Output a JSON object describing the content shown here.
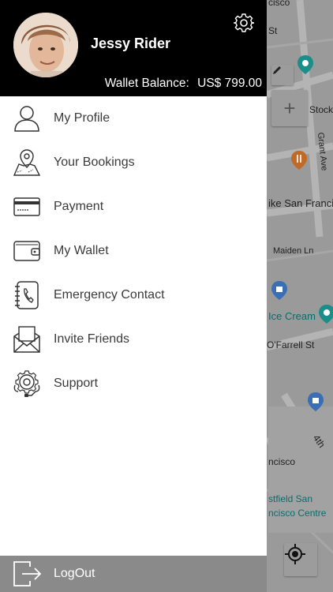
{
  "map": {
    "streets": [
      "cisco",
      "St",
      "Stockt",
      "Grant Ave",
      "ike San Franci",
      "Maiden Ln",
      "Ice Cream",
      "O'Farrell St",
      "4th",
      "ncisco",
      "stfield San",
      "ncisco Centre"
    ],
    "icons": [
      "pin-teal-icon",
      "fork-knife-icon",
      "shopping-bag-icon",
      "pin-teal-icon",
      "shopping-bag-icon"
    ],
    "controls": {
      "zoom_in": "+",
      "edit_icon": "pencil-icon",
      "location_icon": "crosshair-icon"
    }
  },
  "header": {
    "user_name": "Jessy Rider",
    "wallet_label": "Wallet Balance:",
    "wallet_value": "US$ 799.00",
    "settings_icon": "gear-icon"
  },
  "menu": [
    {
      "label": "My Profile",
      "icon": "person-icon"
    },
    {
      "label": "Your Bookings",
      "icon": "map-pin-icon"
    },
    {
      "label": "Payment",
      "icon": "credit-card-icon"
    },
    {
      "label": "My Wallet",
      "icon": "wallet-icon"
    },
    {
      "label": "Emergency Contact",
      "icon": "phone-book-icon"
    },
    {
      "label": "Invite Friends",
      "icon": "envelope-icon"
    },
    {
      "label": "Support",
      "icon": "support-gear-icon"
    }
  ],
  "logout": {
    "label": "LogOut",
    "icon": "logout-icon"
  },
  "colors": {
    "header_bg": "#000000",
    "drawer_bg": "#ffffff",
    "logout_bg": "#8a8a8a",
    "map_bg": "#9a9a9a"
  }
}
